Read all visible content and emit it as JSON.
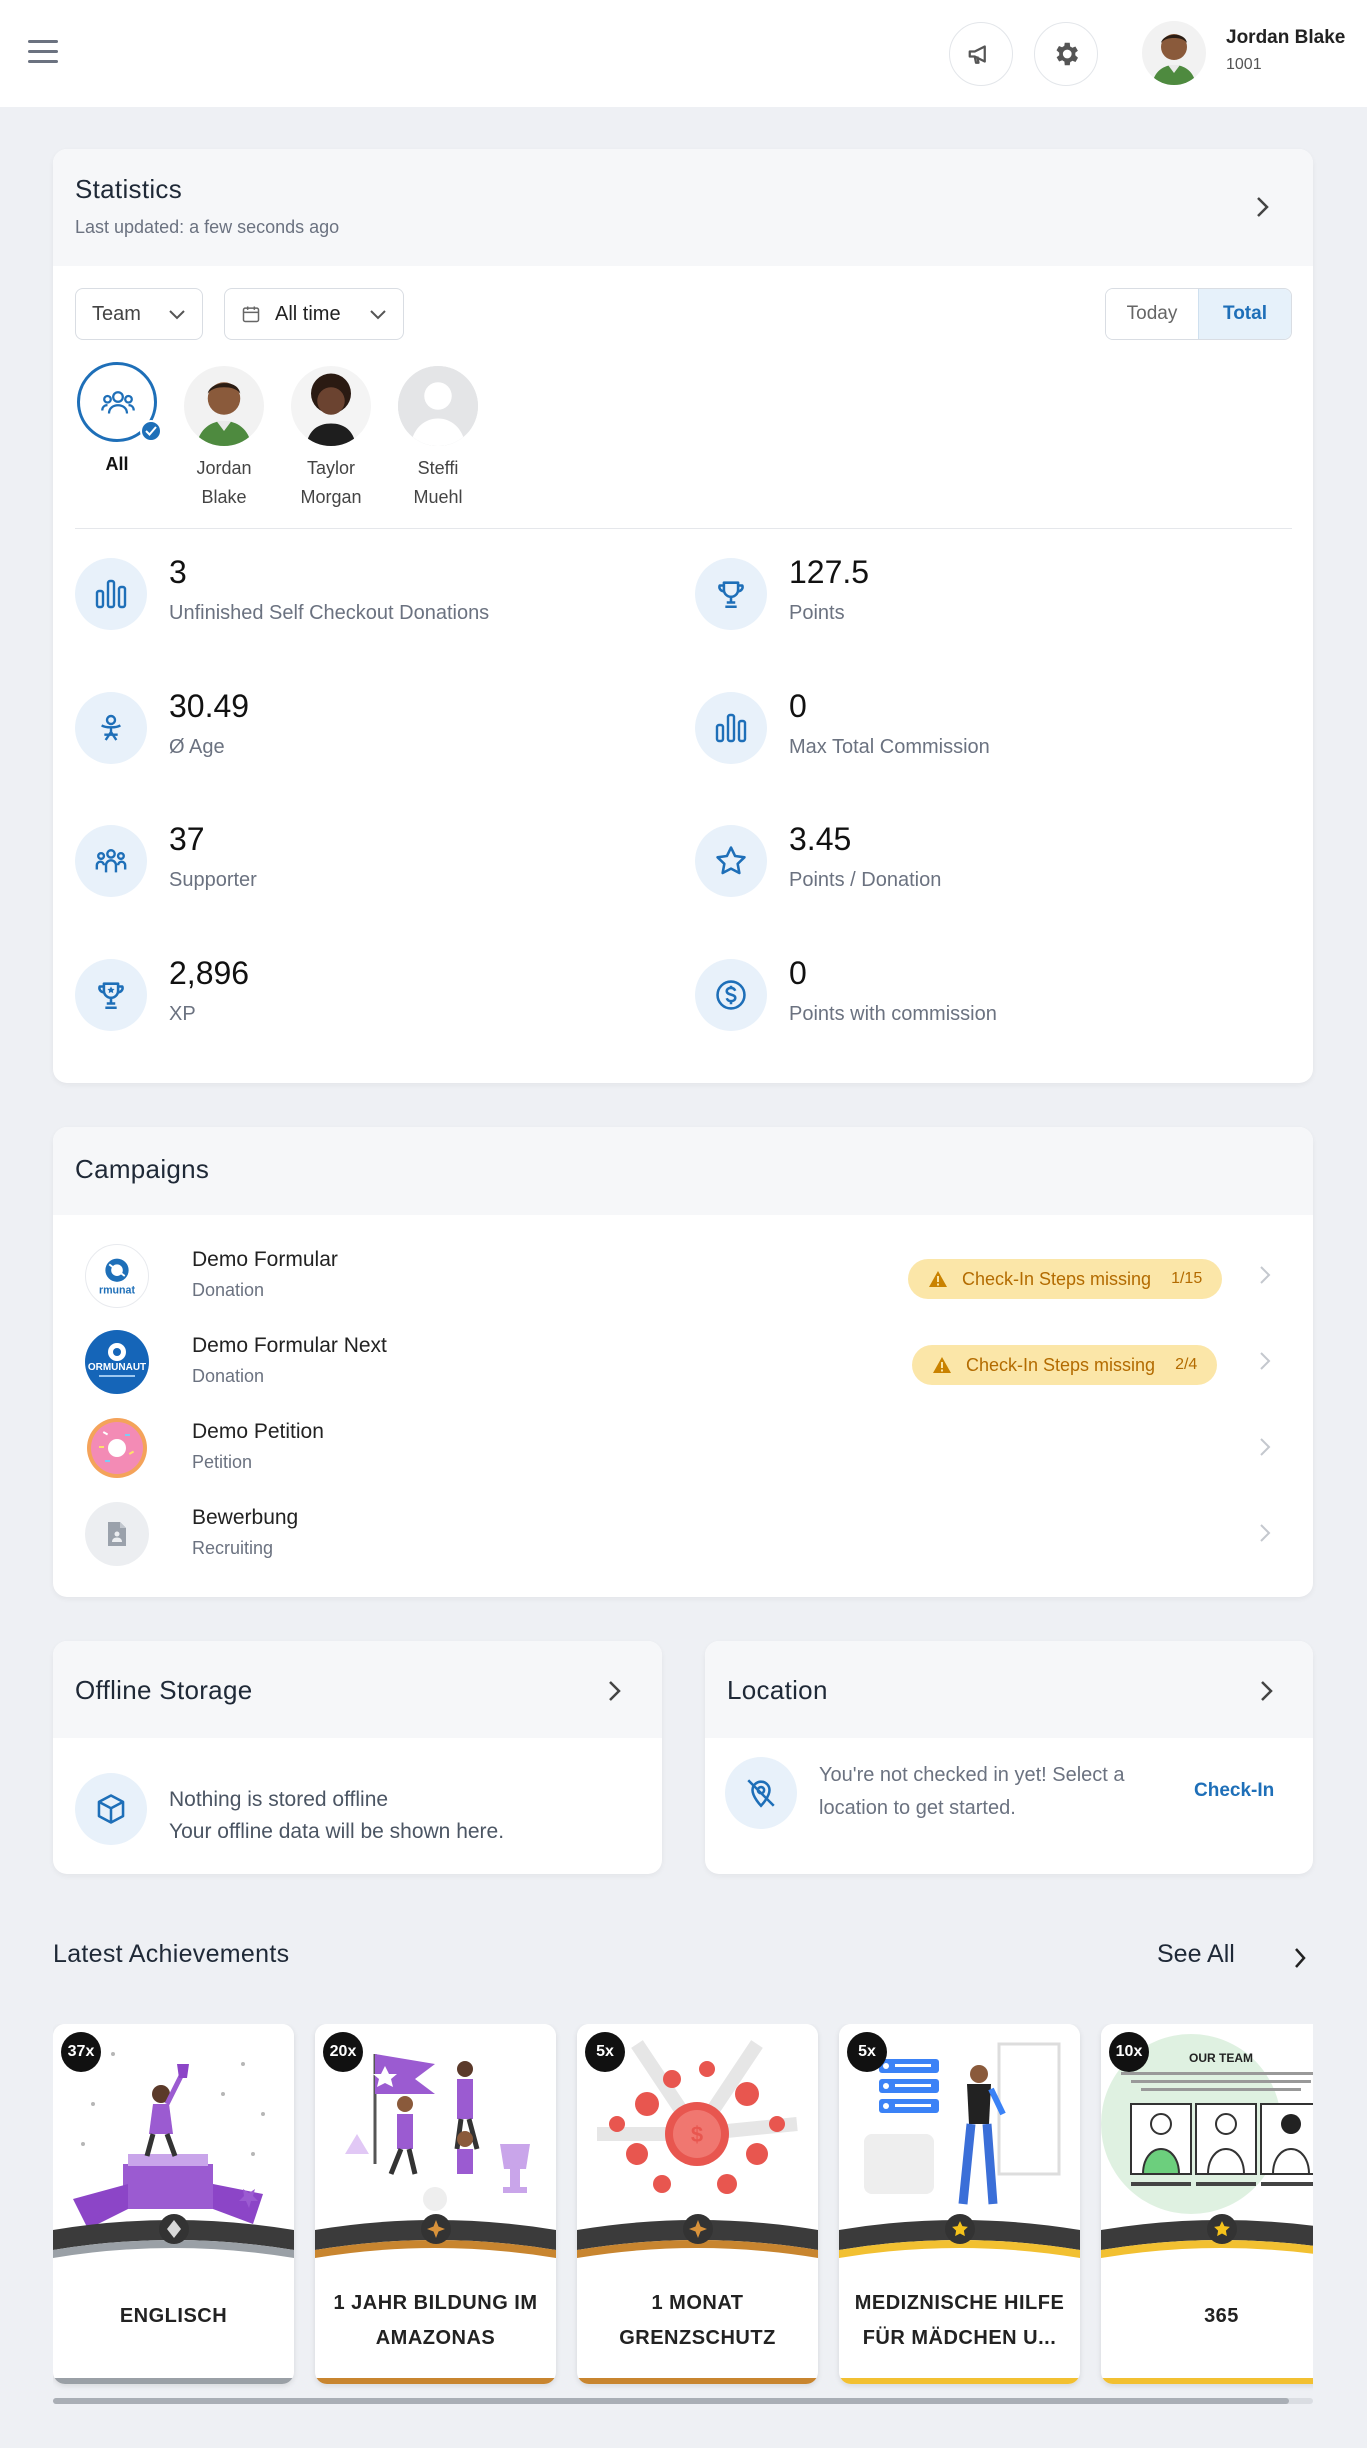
{
  "header": {
    "user_name": "Jordan Blake",
    "user_id": "1001",
    "icons": [
      "menu-icon",
      "megaphone-icon",
      "gear-icon"
    ]
  },
  "statistics": {
    "title": "Statistics",
    "subtitle": "Last updated: a few seconds ago",
    "filter_scope": "Team",
    "filter_time": "All time",
    "toggle": {
      "today": "Today",
      "total": "Total",
      "active": "total"
    },
    "members": [
      {
        "name": "All",
        "selected": true
      },
      {
        "name": "Jordan\nBlake"
      },
      {
        "name": "Taylor\nMorgan"
      },
      {
        "name": "Steffi\nMuehl"
      }
    ],
    "items": [
      {
        "value": "3",
        "label": "Unfinished Self Checkout Donations",
        "icon": "bar-chart-icon"
      },
      {
        "value": "127.5",
        "label": "Points",
        "icon": "trophy-icon"
      },
      {
        "value": "30.49",
        "label": "Ø Age",
        "icon": "person-age-icon"
      },
      {
        "value": "0",
        "label": "Max Total Commission",
        "icon": "bar-chart-icon"
      },
      {
        "value": "37",
        "label": "Supporter",
        "icon": "supporters-icon"
      },
      {
        "value": "3.45",
        "label": "Points / Donation",
        "icon": "star-icon"
      },
      {
        "value": "2,896",
        "label": "XP",
        "icon": "trophy-icon"
      },
      {
        "value": "0",
        "label": "Points with commission",
        "icon": "dollar-icon"
      }
    ]
  },
  "campaigns": {
    "title": "Campaigns",
    "items": [
      {
        "name": "Demo Formular",
        "type": "Donation",
        "warning": "Check-In Steps missing",
        "count": "1/15",
        "logo_text": "rmunat"
      },
      {
        "name": "Demo Formular Next",
        "type": "Donation",
        "warning": "Check-In Steps missing",
        "count": "2/4",
        "logo_text": "ORMUNAUT"
      },
      {
        "name": "Demo Petition",
        "type": "Petition",
        "warning": null,
        "count": null
      },
      {
        "name": "Bewerbung",
        "type": "Recruiting",
        "warning": null,
        "count": null
      }
    ]
  },
  "offline": {
    "title": "Offline Storage",
    "line1": "Nothing is stored offline",
    "line2": "Your offline data will be shown here."
  },
  "location": {
    "title": "Location",
    "line1": "You're not checked in yet! Select a",
    "line2": "location to get started.",
    "action": "Check-In"
  },
  "achievements": {
    "title": "Latest Achievements",
    "see_all": "See All",
    "items": [
      {
        "count": "37x",
        "title": "ENGLISCH",
        "tier": "silver",
        "accent": "#9b5bd1"
      },
      {
        "count": "20x",
        "title": "1 JAHR BILDUNG IM AMAZONAS",
        "tier": "bronze",
        "accent": "#9b5bd1"
      },
      {
        "count": "5x",
        "title": "1 MONAT GRENZSCHUTZ",
        "tier": "bronze",
        "accent": "#e8564f"
      },
      {
        "count": "5x",
        "title": "MEDIZNISCHE HILFE FÜR MÄDCHEN U...",
        "tier": "gold",
        "accent": "#3b82f6"
      },
      {
        "count": "10x",
        "title": "365",
        "tier": "gold",
        "accent": "#4caf50",
        "image_text": "OUR TEAM"
      }
    ]
  },
  "colors": {
    "primary": "#1e6fb8",
    "icon_bg": "#e8f1fa",
    "warning_bg": "#fbe6a8",
    "warning_text": "#b36b00",
    "page_bg": "#eef0f4"
  }
}
